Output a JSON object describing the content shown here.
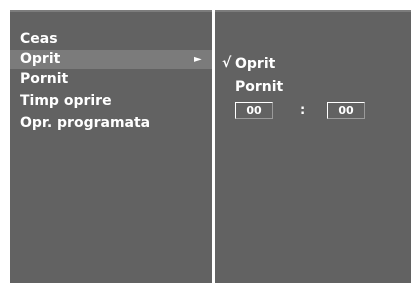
{
  "menu": {
    "items": [
      {
        "label": "Ceas"
      },
      {
        "label": "Oprit",
        "selected": true,
        "arrow": "►"
      },
      {
        "label": "Pornit"
      },
      {
        "label": "Timp oprire"
      },
      {
        "label": "Opr. programata"
      }
    ]
  },
  "submenu": {
    "check_mark": "√",
    "off_label": "Oprit",
    "on_label": "Pornit",
    "hours": "00",
    "separator": ":",
    "minutes": "00"
  },
  "colors": {
    "panel_bg": "#626262",
    "selected_bg": "#7b7b7b",
    "text": "#ffffff"
  }
}
